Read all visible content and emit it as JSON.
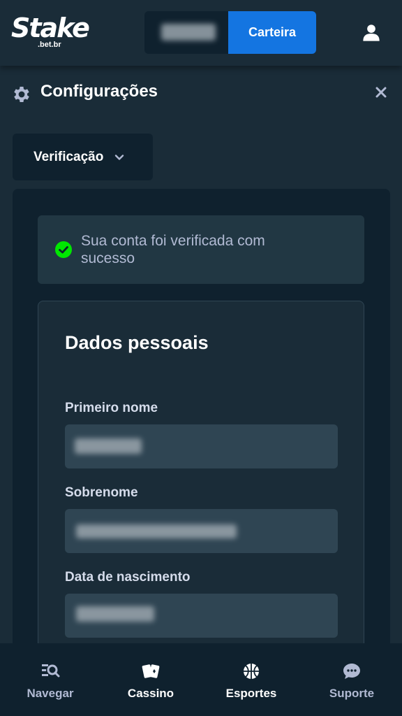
{
  "header": {
    "logo_text": "Stake",
    "logo_sub": ".bet.br",
    "wallet_label": "Carteira"
  },
  "page": {
    "title": "Configurações",
    "section_dropdown": "Verificação"
  },
  "alert": {
    "message": "Sua conta foi verificada com sucesso",
    "status_color": "#00e701"
  },
  "card": {
    "title": "Dados pessoais",
    "fields": [
      {
        "label": "Primeiro nome"
      },
      {
        "label": "Sobrenome"
      },
      {
        "label": "Data de nascimento"
      }
    ]
  },
  "bottom_nav": {
    "items": [
      {
        "label": "Navegar",
        "icon": "browse-icon"
      },
      {
        "label": "Cassino",
        "icon": "cards-icon"
      },
      {
        "label": "Esportes",
        "icon": "basketball-icon"
      },
      {
        "label": "Suporte",
        "icon": "chat-icon"
      }
    ]
  },
  "colors": {
    "background": "#1a2c38",
    "panel": "#0f212e",
    "accent": "#1475e1",
    "input": "#2f4553"
  }
}
